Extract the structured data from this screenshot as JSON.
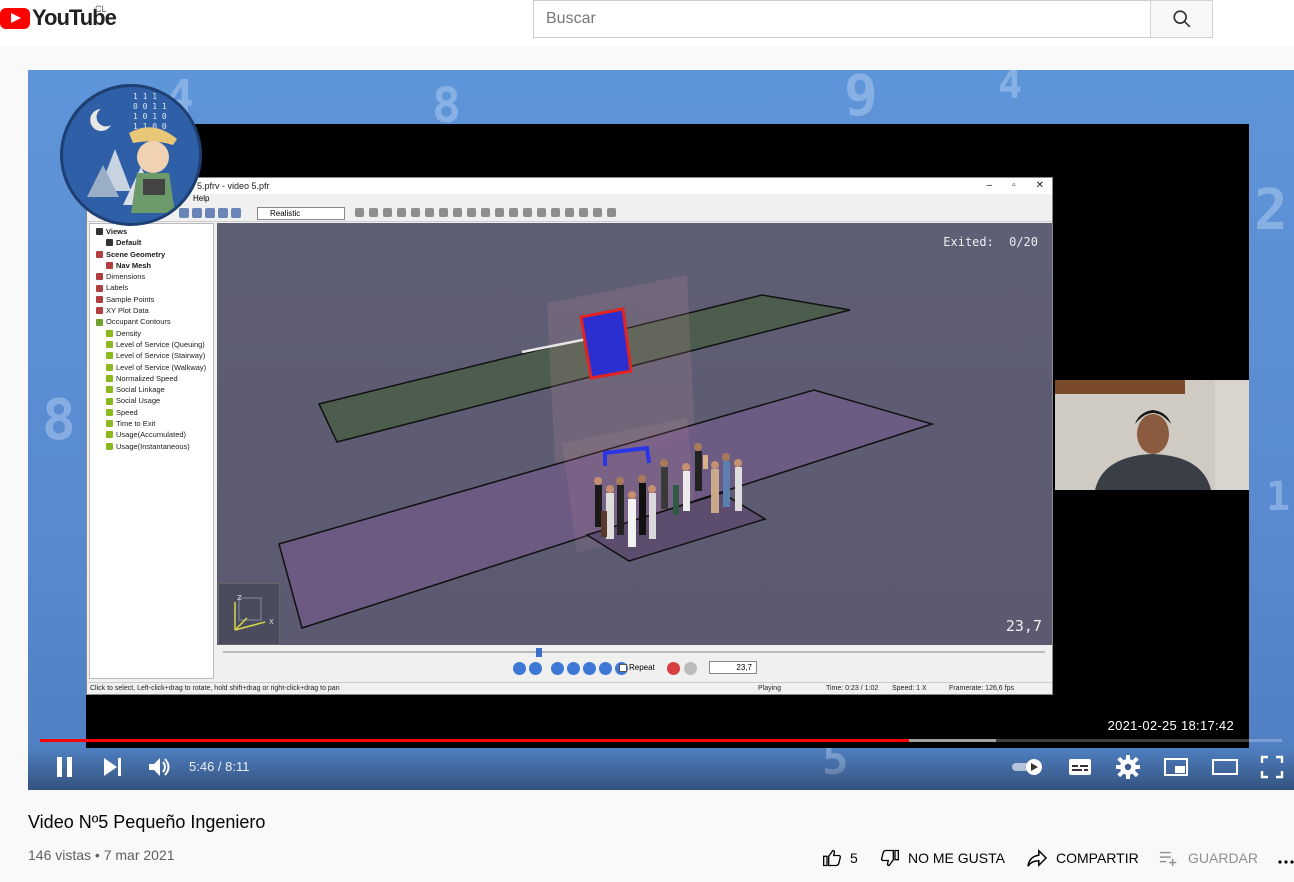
{
  "header": {
    "logo_text": "YouTube",
    "country_code": "CL",
    "search_placeholder": "Buscar"
  },
  "video_frame": {
    "app_title": "5.pfrv - video 5.pfr",
    "menu_help": "Help",
    "render_mode": "Realistic",
    "tree": [
      {
        "label": "Views",
        "level": 0,
        "icon_color": "#333333"
      },
      {
        "label": "Default",
        "level": 1,
        "icon_color": "#333333"
      },
      {
        "label": "Scene Geometry",
        "level": 0,
        "icon_color": "#b04040"
      },
      {
        "label": "Nav Mesh",
        "level": 1,
        "icon_color": "#b04040"
      },
      {
        "label": "Dimensions",
        "level": 0,
        "icon_color": "#b04040"
      },
      {
        "label": "Labels",
        "level": 0,
        "icon_color": "#b04040"
      },
      {
        "label": "Sample Points",
        "level": 0,
        "icon_color": "#b04040"
      },
      {
        "label": "XY Plot Data",
        "level": 0,
        "icon_color": "#b04040"
      },
      {
        "label": "Occupant Contours",
        "level": 0,
        "icon_color": "#70a030"
      },
      {
        "label": "Density",
        "level": 1,
        "icon_color": "#8cb820"
      },
      {
        "label": "Level of Service (Queuing)",
        "level": 1,
        "icon_color": "#8cb820"
      },
      {
        "label": "Level of Service (Stairway)",
        "level": 1,
        "icon_color": "#8cb820"
      },
      {
        "label": "Level of Service (Walkway)",
        "level": 1,
        "icon_color": "#8cb820"
      },
      {
        "label": "Normalized Speed",
        "level": 1,
        "icon_color": "#8cb820"
      },
      {
        "label": "Social Linkage",
        "level": 1,
        "icon_color": "#8cb820"
      },
      {
        "label": "Social Usage",
        "level": 1,
        "icon_color": "#8cb820"
      },
      {
        "label": "Speed",
        "level": 1,
        "icon_color": "#8cb820"
      },
      {
        "label": "Time to Exit",
        "level": 1,
        "icon_color": "#8cb820"
      },
      {
        "label": "Usage(Accumulated)",
        "level": 1,
        "icon_color": "#8cb820"
      },
      {
        "label": "Usage(Instantaneous)",
        "level": 1,
        "icon_color": "#8cb820"
      }
    ],
    "exited_label": "Exited:",
    "exited_value": "0/20",
    "time_readout": "23,7",
    "repeat_label": "Repeat",
    "time_field": "23,7",
    "status_hint": "Click to select, Left-click+drag to rotate, hold shift+drag or right-click+drag to pan",
    "status_state": "Playing",
    "status_time": "Time: 0:23 / 1:02",
    "status_speed": "Speed: 1 X",
    "status_framerate": "Framerate: 126,6 fps",
    "recording_timestamp": "2021-02-25  18:17:42"
  },
  "player": {
    "current_time": "5:46",
    "duration": "8:11",
    "time_display": "5:46 / 8:11",
    "played_fraction": 0.7,
    "buffered_fraction": 0.77
  },
  "info": {
    "title": "Video Nº5 Pequeño Ingeniero",
    "views_date": "146 vistas • 7 mar 2021",
    "likes": "5",
    "dislike_label": "NO ME GUSTA",
    "share_label": "COMPARTIR",
    "save_label": "GUARDAR"
  },
  "colors": {
    "brand_red": "#ff0000",
    "progress_red": "#ff0000"
  }
}
